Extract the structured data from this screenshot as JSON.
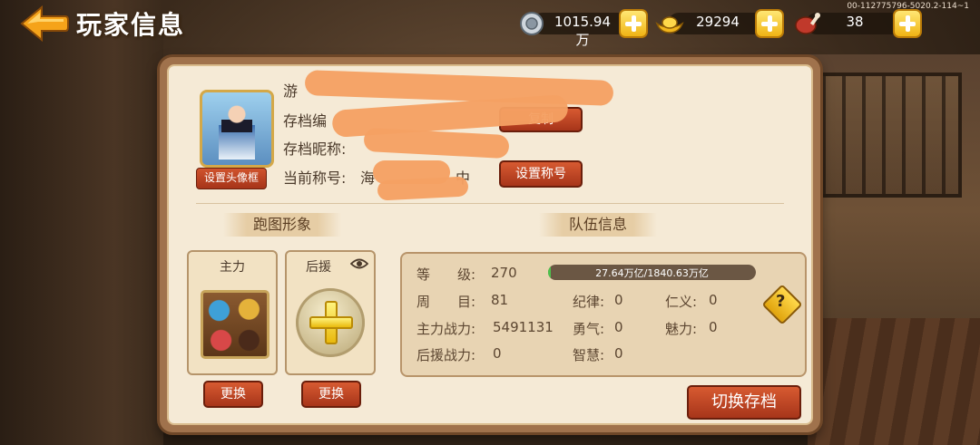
{
  "header": {
    "title": "玩家信息",
    "version": "00-112775796-5020.2-114~1"
  },
  "resources": {
    "silver": "1015.94万",
    "gold": "29294",
    "meat": "38"
  },
  "profile": {
    "name_label": "游",
    "archive_id_label": "存档编",
    "archive_nick_label": "存档昵称:",
    "title_label": "当前称号:",
    "title_value": "海",
    "title_tail": "中",
    "copy_button": "复制",
    "set_frame_button": "设置头像框",
    "set_title_button": "设置称号"
  },
  "running_image": {
    "section_title": "跑图形象",
    "main_label": "主力",
    "support_label": "后援",
    "change_button": "更换"
  },
  "team": {
    "section_title": "队伍信息",
    "level_label": "等　　级:",
    "level": "270",
    "exp_text": "27.64万亿/1840.63万亿",
    "exp_fraction": 0.015,
    "round_label": "周　　目:",
    "round": "81",
    "discipline_label": "纪律:",
    "discipline": "0",
    "benevolence_label": "仁义:",
    "benevolence": "0",
    "main_power_label": "主力战力:",
    "main_power": "5491131",
    "courage_label": "勇气:",
    "courage": "0",
    "charm_label": "魅力:",
    "charm": "0",
    "support_power_label": "后援战力:",
    "support_power": "0",
    "wisdom_label": "智慧:",
    "wisdom": "0"
  },
  "switch_button": "切换存档"
}
